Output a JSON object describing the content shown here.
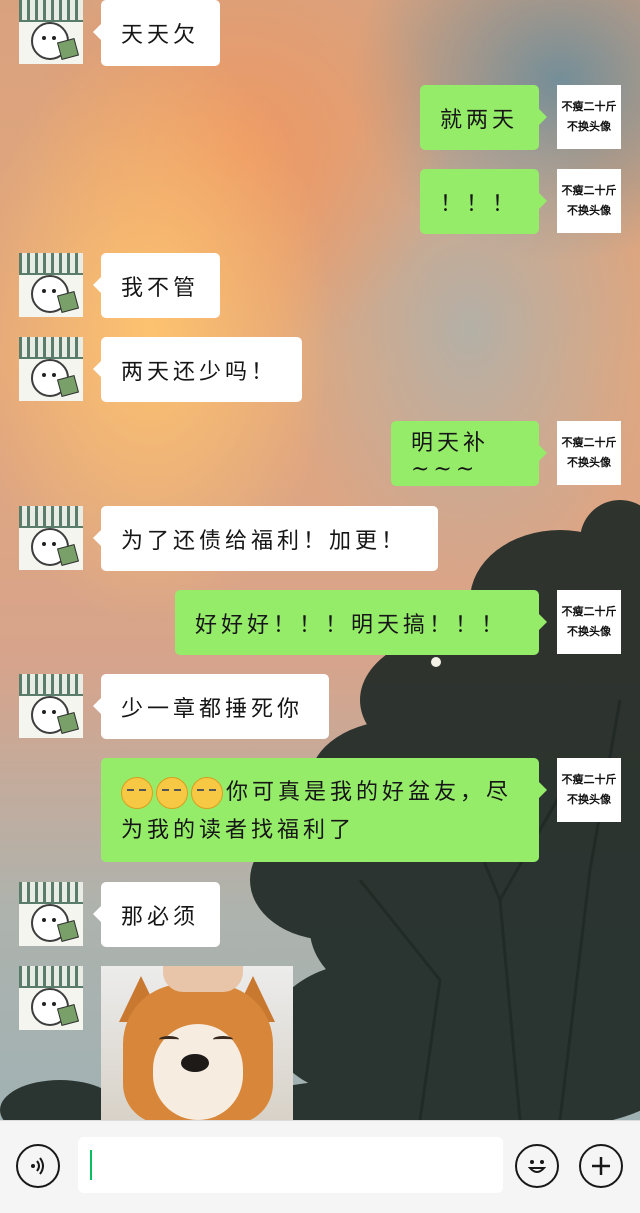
{
  "messages": [
    {
      "side": "left",
      "text": "天天欠"
    },
    {
      "side": "right",
      "text": "就两天"
    },
    {
      "side": "right",
      "text": "！！！"
    },
    {
      "side": "left",
      "text": "我不管"
    },
    {
      "side": "left",
      "text": "两天还少吗！"
    },
    {
      "side": "right",
      "text": "明天补~~~"
    },
    {
      "side": "left",
      "text": "为了还债给福利！加更！"
    },
    {
      "side": "right",
      "text": "好好好！！！明天搞！！！"
    },
    {
      "side": "left",
      "text": "少一章都捶死你"
    },
    {
      "side": "right",
      "text_line1": "你可真是我的好盆友，尽",
      "text_line2": "为我的读者找福利了",
      "emoji_count": 3,
      "emoji_name": "smirk-face-emoji"
    },
    {
      "side": "left",
      "text": "那必须"
    },
    {
      "side": "left",
      "type": "image",
      "image_name": "shiba-dog-photo"
    }
  ],
  "self_avatar": {
    "line1": "不瘦二十斤",
    "line2": "不换头像"
  },
  "input_bar": {
    "voice_icon": "voice-icon",
    "emoji_icon": "emoji-icon",
    "plus_icon": "plus-icon",
    "value": "",
    "cursor_color": "#07c160"
  },
  "colors": {
    "self_bubble": "#95ec69",
    "other_bubble": "#ffffff"
  }
}
